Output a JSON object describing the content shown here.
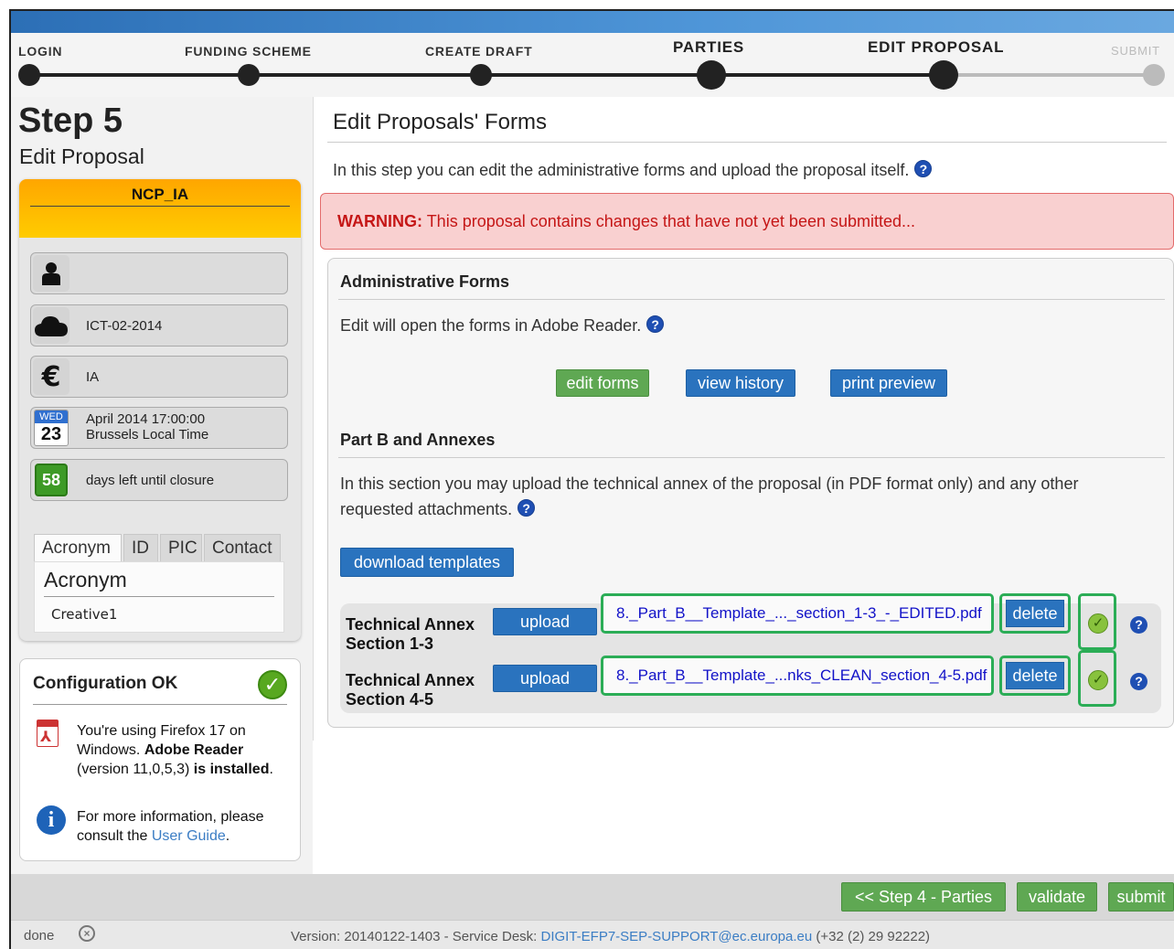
{
  "wizard": {
    "steps": [
      {
        "label": "LOGIN"
      },
      {
        "label": "FUNDING SCHEME"
      },
      {
        "label": "CREATE DRAFT"
      },
      {
        "label": "PARTIES"
      },
      {
        "label": "EDIT PROPOSAL"
      },
      {
        "label": "SUBMIT"
      }
    ]
  },
  "left": {
    "step_title": "Step 5",
    "step_subtitle": "Edit Proposal",
    "card_title": "NCP_IA",
    "call_id": "ICT-02-2014",
    "funding_type": "IA",
    "calendar_day": "WED",
    "calendar_date": "23",
    "deadline_line1": "April 2014  17:00:00",
    "deadline_line2": "Brussels Local Time",
    "days_left": "58",
    "days_left_text": "days left until closure",
    "tabs": [
      "Acronym",
      "ID",
      "PIC",
      "Contact"
    ],
    "acronym_heading": "Acronym",
    "acronym_value": "Creative1",
    "config": {
      "heading": "Configuration OK",
      "line1_a": "You're using Firefox 17 on Windows.",
      "line1_b": "Adobe Reader",
      "line1_c": "(version 11,0,5,3)",
      "line1_d": "is installed",
      "line1_e": ".",
      "line2_a": "For more information, please consult the",
      "line2_link": "User Guide",
      "line2_b": "."
    }
  },
  "main": {
    "title": "Edit Proposals' Forms",
    "intro": "In this step you can edit the administrative forms and upload the proposal itself.",
    "warning_label": "WARNING:",
    "warning_text": "This proposal contains changes that have not yet been submitted...",
    "admin": {
      "heading": "Administrative Forms",
      "text": "Edit will open the forms in Adobe Reader.",
      "edit_forms": "edit forms",
      "view_history": "view history",
      "print_preview": "print preview"
    },
    "partb": {
      "heading": "Part B and Annexes",
      "text_line1": "In this section you may upload the technical annex of the proposal (in PDF format only) and any other",
      "text_line2": "requested attachments.",
      "download_templates": "download templates",
      "rows": [
        {
          "label1": "Technical Annex",
          "label2": "Section 1-3",
          "upload": "upload",
          "file": "8._Part_B__Template_..._section_1-3_-_EDITED.pdf",
          "delete": "delete"
        },
        {
          "label1": "Technical Annex",
          "label2": "Section 4-5",
          "upload": "upload",
          "file": "8._Part_B__Template_...nks_CLEAN_section_4-5.pdf",
          "delete": "delete"
        }
      ]
    }
  },
  "footer": {
    "prev": "<< Step 4 - Parties",
    "validate": "validate",
    "submit": "submit",
    "status_done": "done",
    "version_text": "Version: 20140122-1403 - Service Desk: ",
    "service_email": "DIGIT-EFP7-SEP-SUPPORT@ec.europa.eu",
    "phone": " (+32 (2) 29 92222)"
  },
  "colors": {
    "primary_blue": "#2a73be",
    "action_green": "#5fa853",
    "warning_red": "#c51616",
    "highlight_green": "#2bad56",
    "card_orange": "#ffa600"
  }
}
